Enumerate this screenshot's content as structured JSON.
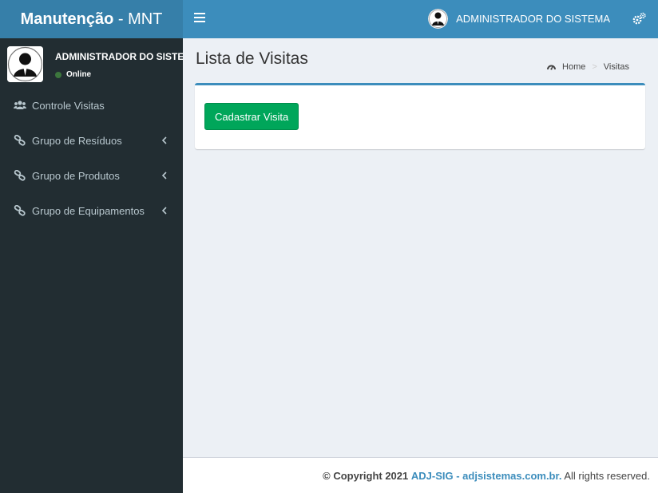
{
  "app": {
    "logo_bold": "Manutenção",
    "logo_rest": " - MNT"
  },
  "topbar": {
    "user_name": "ADMINISTRADOR DO SISTEMA",
    "menu_toggle_icon": "hamburger-icon",
    "settings_icon": "gears-icon"
  },
  "sidebar": {
    "user": {
      "name": "ADMINISTRADOR DO SISTEMA",
      "status": "Online"
    },
    "items": [
      {
        "label": "Controle Visitas",
        "icon": "users-icon",
        "expandable": false
      },
      {
        "label": "Grupo de Resíduos",
        "icon": "link-icon",
        "expandable": true
      },
      {
        "label": "Grupo de Produtos",
        "icon": "link-icon",
        "expandable": true
      },
      {
        "label": "Grupo de Equipamentos",
        "icon": "link-icon",
        "expandable": true
      }
    ]
  },
  "content": {
    "title": "Lista de Visitas",
    "breadcrumb": {
      "home": "Home",
      "current": "Visitas"
    },
    "register_button": "Cadastrar Visita"
  },
  "footer": {
    "copyright": "© Copyright 2021",
    "company": "ADJ-SIG",
    "separator": " - ",
    "site": "adjsistemas.com.br.",
    "rights": " All rights reserved."
  },
  "colors": {
    "header": "#3c8dbc",
    "logo_bg": "#367fa9",
    "sidebar": "#222d32",
    "success": "#00a65a",
    "content_bg": "#ecf0f5"
  }
}
